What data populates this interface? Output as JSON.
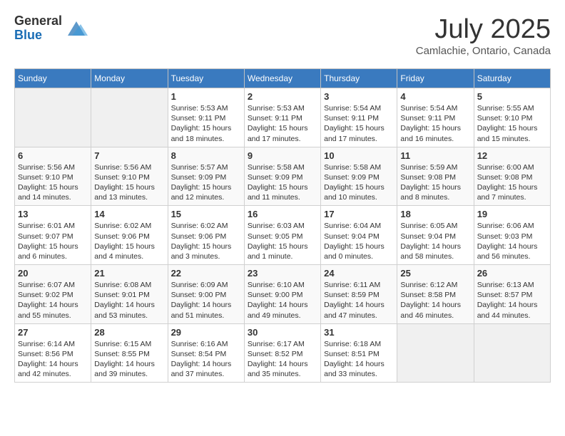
{
  "header": {
    "logo_general": "General",
    "logo_blue": "Blue",
    "title": "July 2025",
    "location": "Camlachie, Ontario, Canada"
  },
  "weekdays": [
    "Sunday",
    "Monday",
    "Tuesday",
    "Wednesday",
    "Thursday",
    "Friday",
    "Saturday"
  ],
  "weeks": [
    [
      {
        "day": "",
        "sunrise": "",
        "sunset": "",
        "daylight": ""
      },
      {
        "day": "",
        "sunrise": "",
        "sunset": "",
        "daylight": ""
      },
      {
        "day": "1",
        "sunrise": "Sunrise: 5:53 AM",
        "sunset": "Sunset: 9:11 PM",
        "daylight": "Daylight: 15 hours and 18 minutes."
      },
      {
        "day": "2",
        "sunrise": "Sunrise: 5:53 AM",
        "sunset": "Sunset: 9:11 PM",
        "daylight": "Daylight: 15 hours and 17 minutes."
      },
      {
        "day": "3",
        "sunrise": "Sunrise: 5:54 AM",
        "sunset": "Sunset: 9:11 PM",
        "daylight": "Daylight: 15 hours and 17 minutes."
      },
      {
        "day": "4",
        "sunrise": "Sunrise: 5:54 AM",
        "sunset": "Sunset: 9:11 PM",
        "daylight": "Daylight: 15 hours and 16 minutes."
      },
      {
        "day": "5",
        "sunrise": "Sunrise: 5:55 AM",
        "sunset": "Sunset: 9:10 PM",
        "daylight": "Daylight: 15 hours and 15 minutes."
      }
    ],
    [
      {
        "day": "6",
        "sunrise": "Sunrise: 5:56 AM",
        "sunset": "Sunset: 9:10 PM",
        "daylight": "Daylight: 15 hours and 14 minutes."
      },
      {
        "day": "7",
        "sunrise": "Sunrise: 5:56 AM",
        "sunset": "Sunset: 9:10 PM",
        "daylight": "Daylight: 15 hours and 13 minutes."
      },
      {
        "day": "8",
        "sunrise": "Sunrise: 5:57 AM",
        "sunset": "Sunset: 9:09 PM",
        "daylight": "Daylight: 15 hours and 12 minutes."
      },
      {
        "day": "9",
        "sunrise": "Sunrise: 5:58 AM",
        "sunset": "Sunset: 9:09 PM",
        "daylight": "Daylight: 15 hours and 11 minutes."
      },
      {
        "day": "10",
        "sunrise": "Sunrise: 5:58 AM",
        "sunset": "Sunset: 9:09 PM",
        "daylight": "Daylight: 15 hours and 10 minutes."
      },
      {
        "day": "11",
        "sunrise": "Sunrise: 5:59 AM",
        "sunset": "Sunset: 9:08 PM",
        "daylight": "Daylight: 15 hours and 8 minutes."
      },
      {
        "day": "12",
        "sunrise": "Sunrise: 6:00 AM",
        "sunset": "Sunset: 9:08 PM",
        "daylight": "Daylight: 15 hours and 7 minutes."
      }
    ],
    [
      {
        "day": "13",
        "sunrise": "Sunrise: 6:01 AM",
        "sunset": "Sunset: 9:07 PM",
        "daylight": "Daylight: 15 hours and 6 minutes."
      },
      {
        "day": "14",
        "sunrise": "Sunrise: 6:02 AM",
        "sunset": "Sunset: 9:06 PM",
        "daylight": "Daylight: 15 hours and 4 minutes."
      },
      {
        "day": "15",
        "sunrise": "Sunrise: 6:02 AM",
        "sunset": "Sunset: 9:06 PM",
        "daylight": "Daylight: 15 hours and 3 minutes."
      },
      {
        "day": "16",
        "sunrise": "Sunrise: 6:03 AM",
        "sunset": "Sunset: 9:05 PM",
        "daylight": "Daylight: 15 hours and 1 minute."
      },
      {
        "day": "17",
        "sunrise": "Sunrise: 6:04 AM",
        "sunset": "Sunset: 9:04 PM",
        "daylight": "Daylight: 15 hours and 0 minutes."
      },
      {
        "day": "18",
        "sunrise": "Sunrise: 6:05 AM",
        "sunset": "Sunset: 9:04 PM",
        "daylight": "Daylight: 14 hours and 58 minutes."
      },
      {
        "day": "19",
        "sunrise": "Sunrise: 6:06 AM",
        "sunset": "Sunset: 9:03 PM",
        "daylight": "Daylight: 14 hours and 56 minutes."
      }
    ],
    [
      {
        "day": "20",
        "sunrise": "Sunrise: 6:07 AM",
        "sunset": "Sunset: 9:02 PM",
        "daylight": "Daylight: 14 hours and 55 minutes."
      },
      {
        "day": "21",
        "sunrise": "Sunrise: 6:08 AM",
        "sunset": "Sunset: 9:01 PM",
        "daylight": "Daylight: 14 hours and 53 minutes."
      },
      {
        "day": "22",
        "sunrise": "Sunrise: 6:09 AM",
        "sunset": "Sunset: 9:00 PM",
        "daylight": "Daylight: 14 hours and 51 minutes."
      },
      {
        "day": "23",
        "sunrise": "Sunrise: 6:10 AM",
        "sunset": "Sunset: 9:00 PM",
        "daylight": "Daylight: 14 hours and 49 minutes."
      },
      {
        "day": "24",
        "sunrise": "Sunrise: 6:11 AM",
        "sunset": "Sunset: 8:59 PM",
        "daylight": "Daylight: 14 hours and 47 minutes."
      },
      {
        "day": "25",
        "sunrise": "Sunrise: 6:12 AM",
        "sunset": "Sunset: 8:58 PM",
        "daylight": "Daylight: 14 hours and 46 minutes."
      },
      {
        "day": "26",
        "sunrise": "Sunrise: 6:13 AM",
        "sunset": "Sunset: 8:57 PM",
        "daylight": "Daylight: 14 hours and 44 minutes."
      }
    ],
    [
      {
        "day": "27",
        "sunrise": "Sunrise: 6:14 AM",
        "sunset": "Sunset: 8:56 PM",
        "daylight": "Daylight: 14 hours and 42 minutes."
      },
      {
        "day": "28",
        "sunrise": "Sunrise: 6:15 AM",
        "sunset": "Sunset: 8:55 PM",
        "daylight": "Daylight: 14 hours and 39 minutes."
      },
      {
        "day": "29",
        "sunrise": "Sunrise: 6:16 AM",
        "sunset": "Sunset: 8:54 PM",
        "daylight": "Daylight: 14 hours and 37 minutes."
      },
      {
        "day": "30",
        "sunrise": "Sunrise: 6:17 AM",
        "sunset": "Sunset: 8:52 PM",
        "daylight": "Daylight: 14 hours and 35 minutes."
      },
      {
        "day": "31",
        "sunrise": "Sunrise: 6:18 AM",
        "sunset": "Sunset: 8:51 PM",
        "daylight": "Daylight: 14 hours and 33 minutes."
      },
      {
        "day": "",
        "sunrise": "",
        "sunset": "",
        "daylight": ""
      },
      {
        "day": "",
        "sunrise": "",
        "sunset": "",
        "daylight": ""
      }
    ]
  ]
}
